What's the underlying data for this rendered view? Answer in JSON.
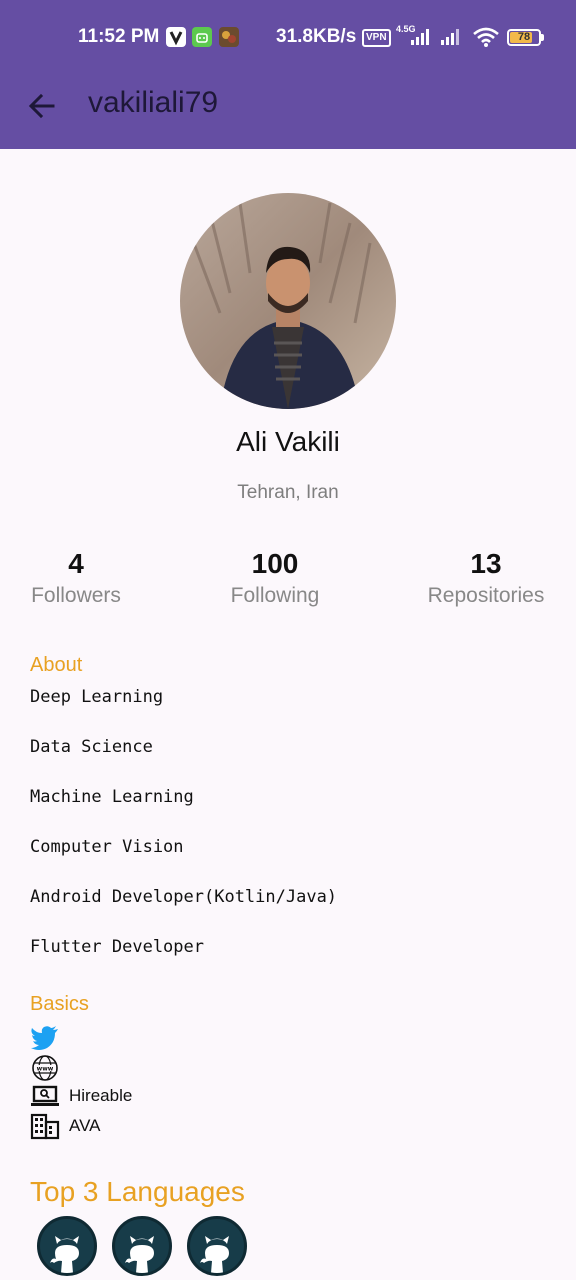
{
  "status_bar": {
    "time": "11:52 PM",
    "speed": "31.8KB/s",
    "vpn": "VPN",
    "network": "4.5G",
    "battery": "78",
    "battery_level": 0.78
  },
  "app_bar": {
    "title": "vakiliali79"
  },
  "profile": {
    "name": "Ali Vakili",
    "location": "Tehran, Iran"
  },
  "stats": [
    {
      "value": "4",
      "label": "Followers"
    },
    {
      "value": "100",
      "label": "Following"
    },
    {
      "value": "13",
      "label": "Repositories"
    }
  ],
  "about": {
    "title": "About",
    "items": [
      "Deep Learning",
      "Data Science",
      "Machine Learning",
      "Computer Vision",
      "Android Developer(Kotlin/Java)",
      "Flutter Developer"
    ]
  },
  "basics": {
    "title": "Basics",
    "items": [
      {
        "icon": "twitter-icon",
        "text": ""
      },
      {
        "icon": "www-icon",
        "text": ""
      },
      {
        "icon": "laptop-search-icon",
        "text": "Hireable"
      },
      {
        "icon": "building-icon",
        "text": "AVA"
      }
    ]
  },
  "languages": {
    "title": "Top 3 Languages",
    "badges": [
      "github-icon",
      "github-icon",
      "github-icon"
    ]
  },
  "colors": {
    "primary": "#654ea3",
    "accent": "#e8a122",
    "background": "#fcf8fc",
    "twitter": "#1da1f2"
  }
}
